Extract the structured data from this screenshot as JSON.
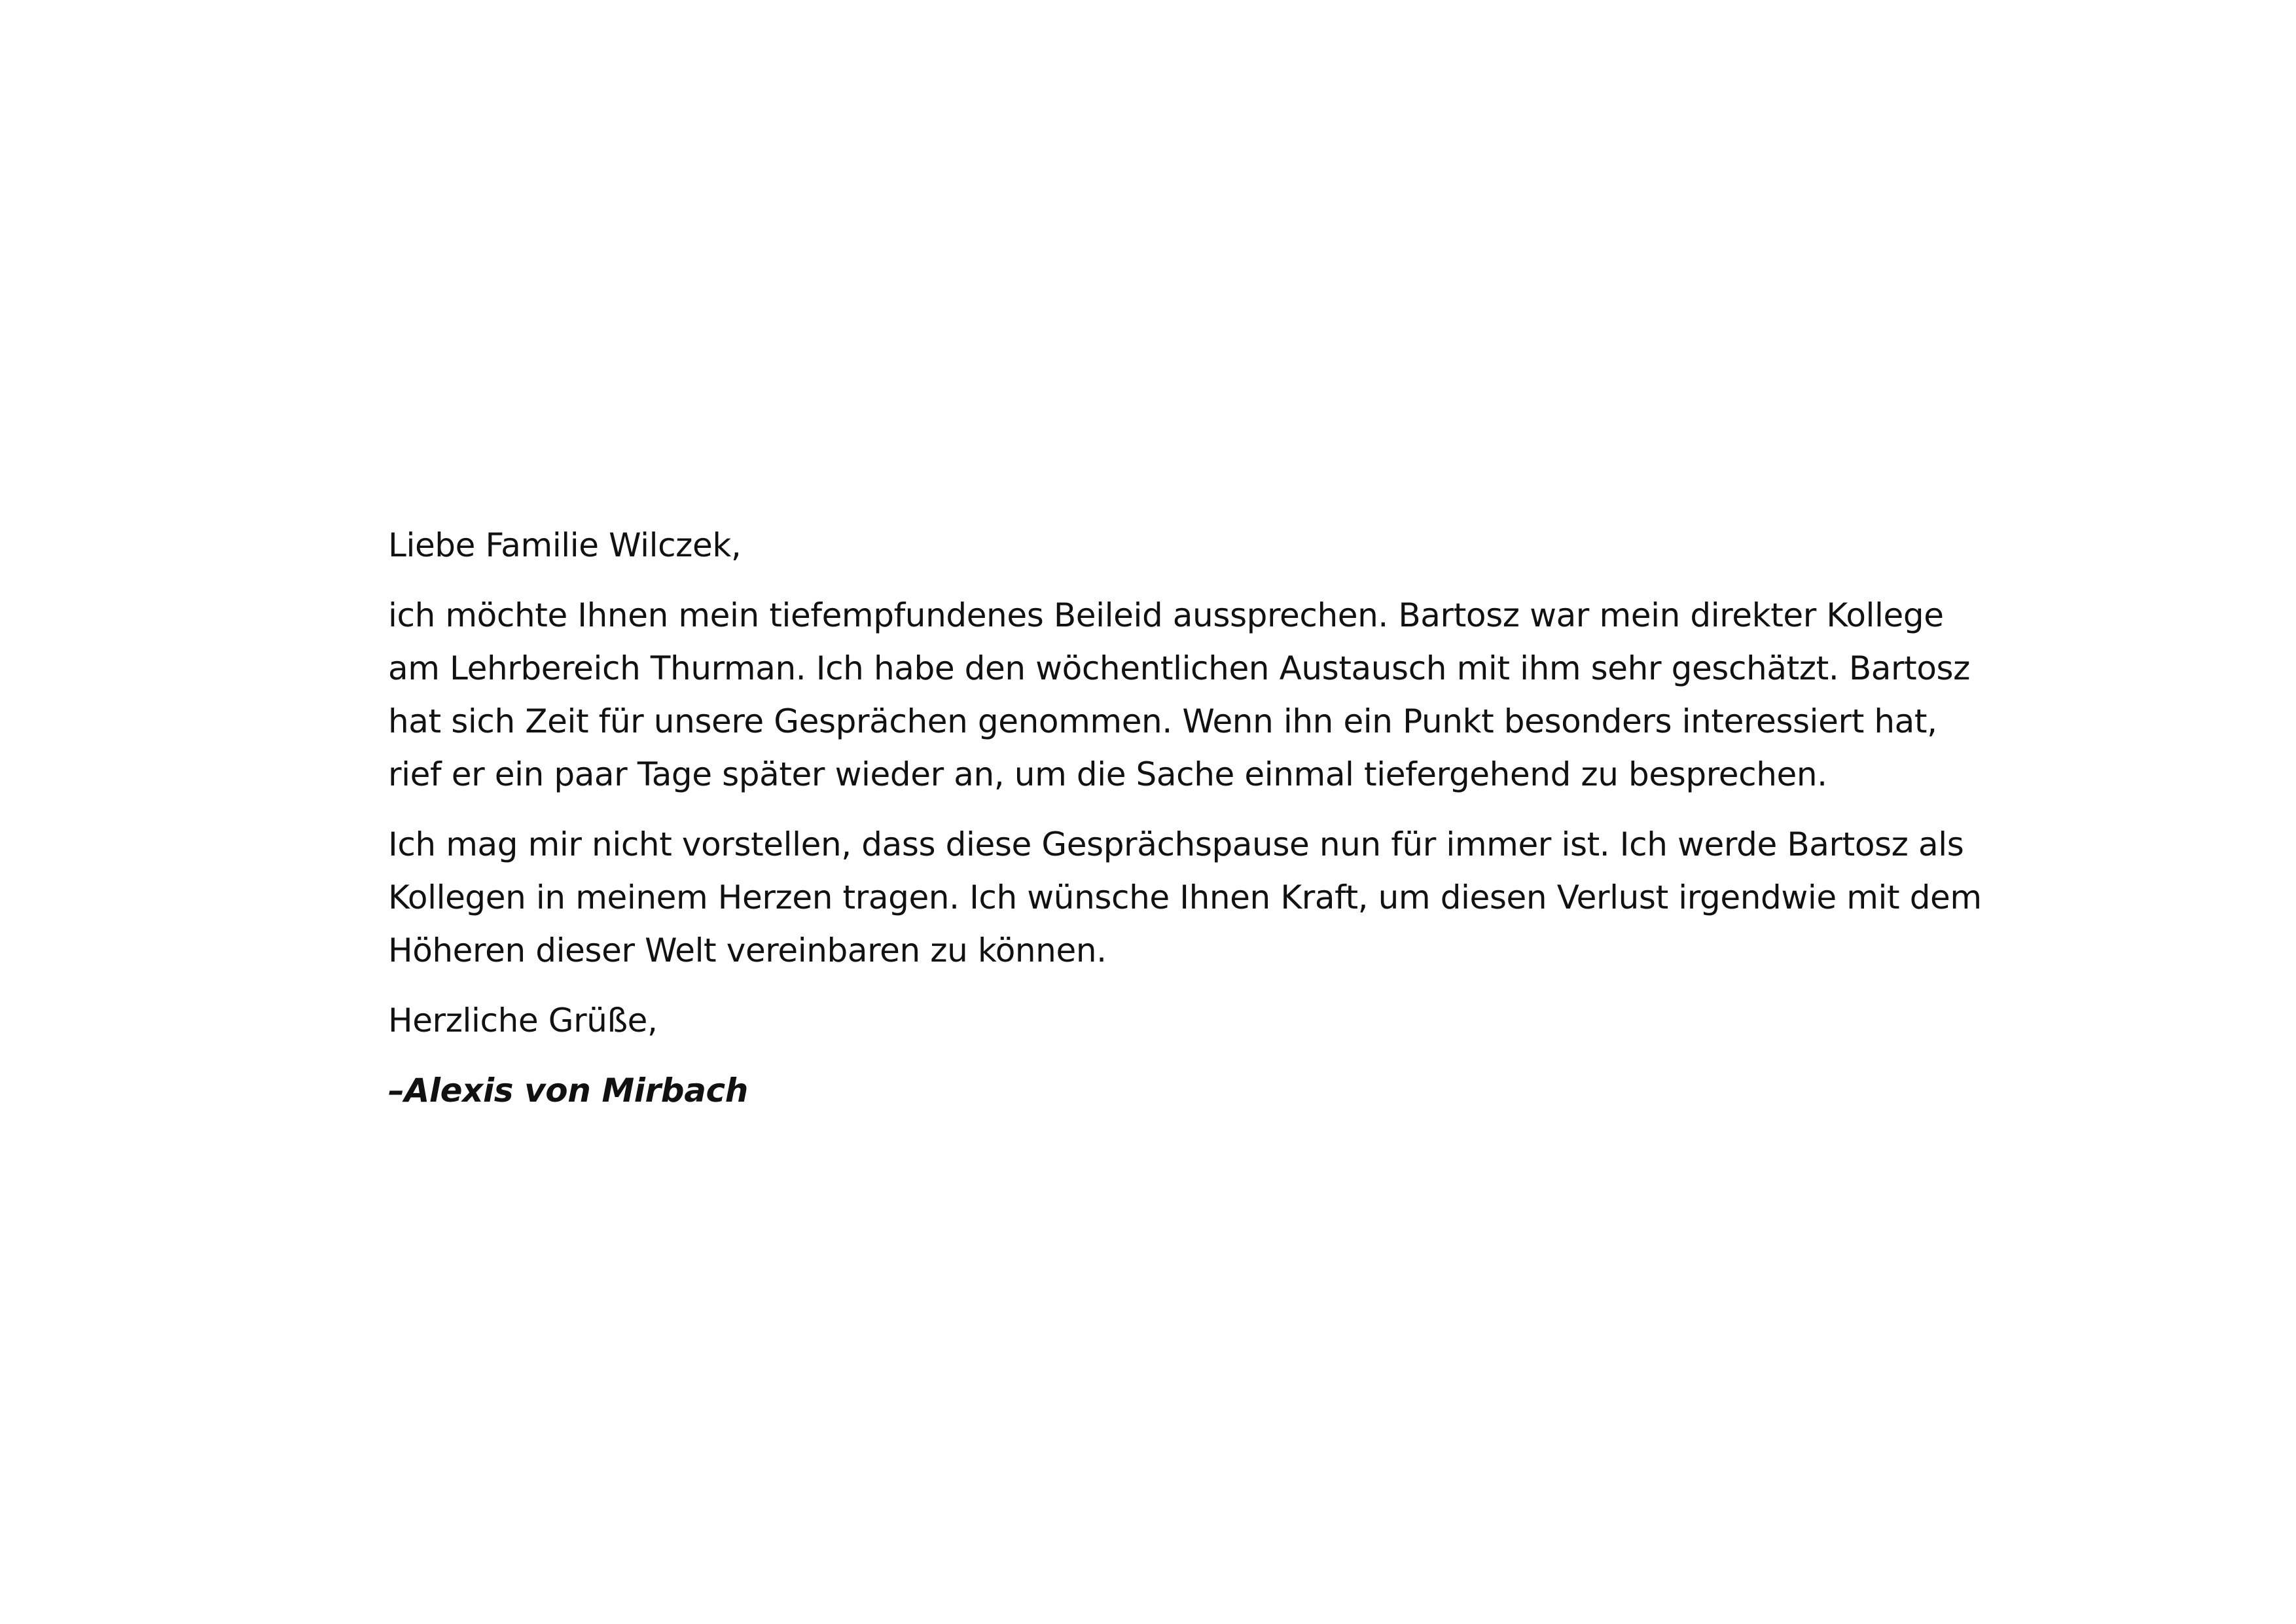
{
  "letter": {
    "salutation": "Liebe Familie Wilczek,",
    "paragraphs": [
      "ich möchte Ihnen mein tiefempfundenes Beileid aussprechen. Bartosz war mein direkter Kollege am Lehrbereich Thurman. Ich habe den wöchentlichen Austausch mit ihm sehr geschätzt. Bartosz hat sich Zeit für unsere Gesprächen genommen. Wenn ihn ein Punkt besonders interessiert hat, rief er ein paar Tage später wieder an, um die Sache einmal tiefergehend zu besprechen.",
      "Ich mag mir nicht vorstellen, dass diese Gesprächspause nun für immer ist. Ich werde Bartosz als Kollegen in meinem Herzen tragen. Ich wünsche Ihnen Kraft, um diesen Verlust irgendwie mit dem Höheren dieser Welt vereinbaren zu können."
    ],
    "closing": "Herzliche Grüße,",
    "signature": "–Alexis von Mirbach"
  }
}
